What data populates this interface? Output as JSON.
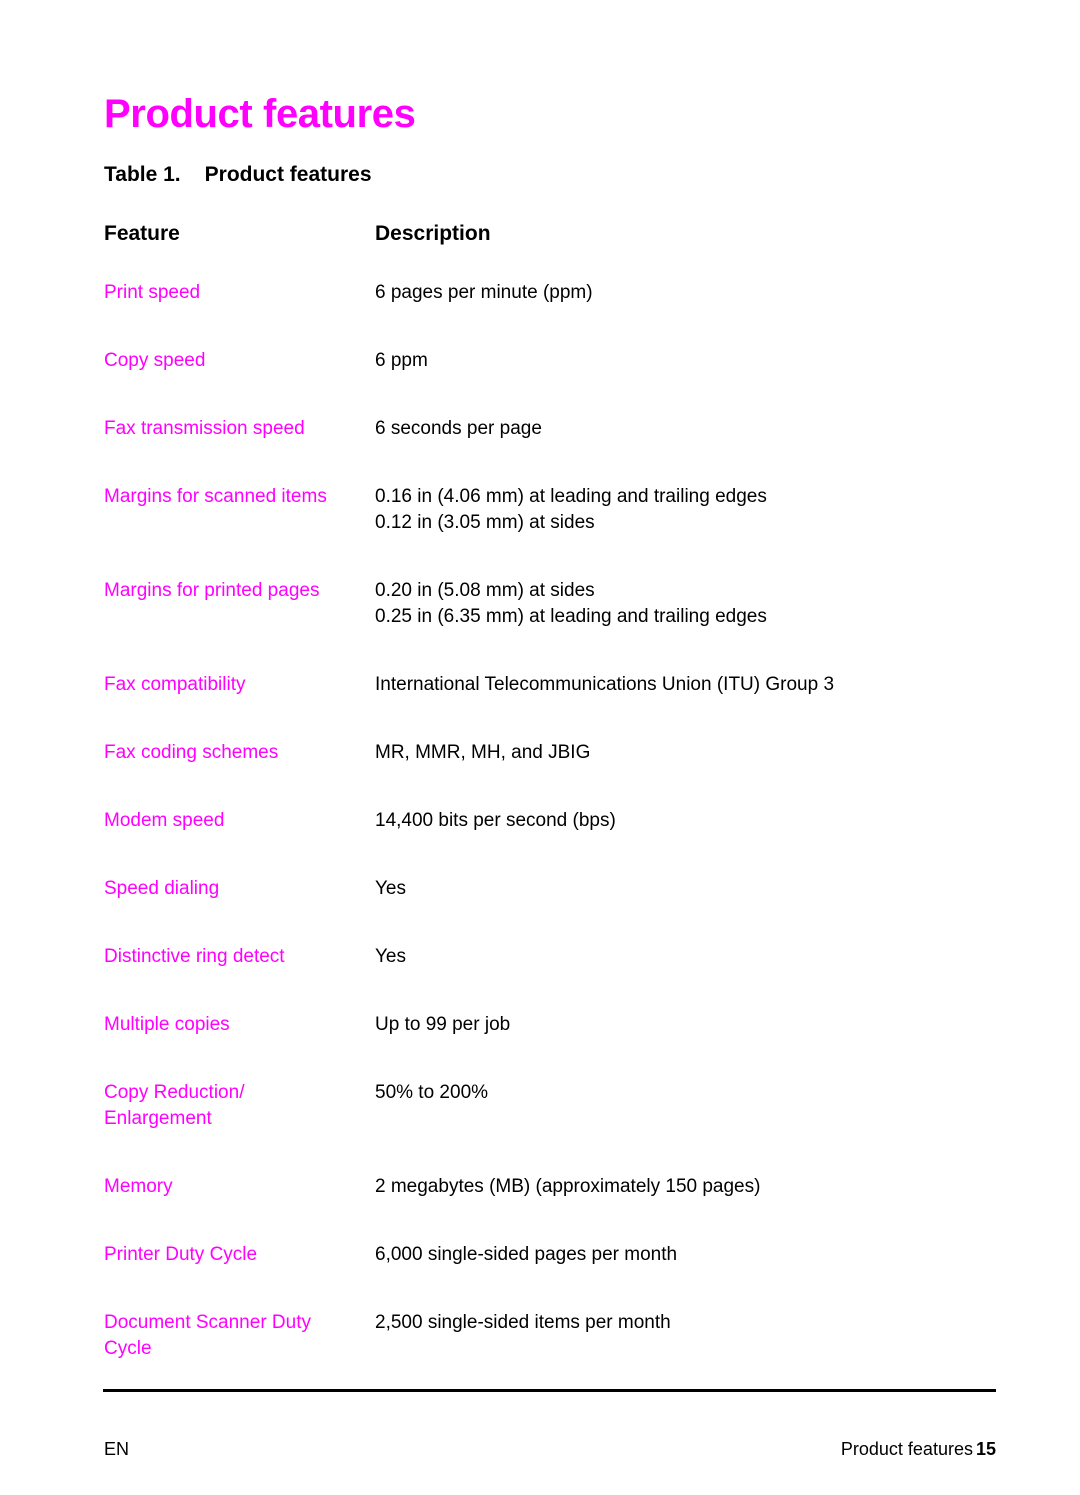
{
  "colors": {
    "accent_magenta": "#ff00ff",
    "text_black": "#000000",
    "page_background": "#ffffff",
    "rule": "#000000"
  },
  "chapter": {
    "title": "Product features"
  },
  "table": {
    "caption_label": "Table 1.",
    "caption_text": "Product features",
    "columns": [
      {
        "key": "feature",
        "header": "Feature"
      },
      {
        "key": "description",
        "header": "Description"
      }
    ],
    "rows": [
      {
        "feature": [
          "Print speed"
        ],
        "description": [
          "6 pages per minute (ppm)"
        ]
      },
      {
        "feature": [
          "Copy speed"
        ],
        "description": [
          "6 ppm"
        ]
      },
      {
        "feature": [
          "Fax transmission speed"
        ],
        "description": [
          "6 seconds per page"
        ]
      },
      {
        "feature": [
          "Margins for scanned items"
        ],
        "description": [
          "0.16 in (4.06 mm) at leading and trailing edges",
          "0.12 in (3.05 mm) at sides"
        ]
      },
      {
        "feature": [
          "Margins for printed pages"
        ],
        "description": [
          "0.20 in (5.08 mm) at sides",
          "0.25 in (6.35 mm) at leading and trailing edges"
        ]
      },
      {
        "feature": [
          "Fax compatibility"
        ],
        "description": [
          "International Telecommunications Union (ITU) Group 3"
        ]
      },
      {
        "feature": [
          "Fax coding schemes"
        ],
        "description": [
          "MR, MMR, MH, and JBIG"
        ]
      },
      {
        "feature": [
          "Modem speed"
        ],
        "description": [
          "14,400 bits per second (bps)"
        ]
      },
      {
        "feature": [
          "Speed dialing"
        ],
        "description": [
          "Yes"
        ]
      },
      {
        "feature": [
          "Distinctive ring detect"
        ],
        "description": [
          "Yes"
        ]
      },
      {
        "feature": [
          "Multiple copies"
        ],
        "description": [
          "Up to 99 per job"
        ]
      },
      {
        "feature": [
          "Copy Reduction/",
          "Enlargement"
        ],
        "description": [
          "50% to 200%"
        ]
      },
      {
        "feature": [
          "Memory"
        ],
        "description": [
          "2 megabytes (MB) (approximately 150 pages)"
        ]
      },
      {
        "feature": [
          "Printer Duty Cycle"
        ],
        "description": [
          "6,000 single-sided pages per month"
        ]
      },
      {
        "feature": [
          "Document Scanner Duty",
          "Cycle"
        ],
        "description": [
          "2,500 single-sided items per month"
        ]
      }
    ]
  },
  "footer": {
    "language_code": "EN",
    "running_title": "Product features",
    "page_number": "15"
  }
}
